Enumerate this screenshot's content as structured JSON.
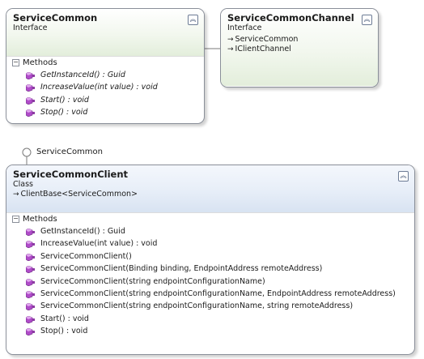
{
  "service_common": {
    "title": "ServiceCommon",
    "kind": "Interface",
    "section": "Methods",
    "methods": [
      "GetInstanceId() : Guid",
      "IncreaseValue(int value) : void",
      "Start() : void",
      "Stop() : void"
    ]
  },
  "service_common_channel": {
    "title": "ServiceCommonChannel",
    "kind": "Interface",
    "inherits": [
      "ServiceCommon",
      "IClientChannel"
    ]
  },
  "lollipop": {
    "label": "ServiceCommon"
  },
  "service_common_client": {
    "title": "ServiceCommonClient",
    "kind": "Class",
    "base": "ClientBase<ServiceCommon>",
    "section": "Methods",
    "methods": [
      "GetInstanceId() : Guid",
      "IncreaseValue(int value) : void",
      "ServiceCommonClient()",
      "ServiceCommonClient(Binding binding, EndpointAddress remoteAddress)",
      "ServiceCommonClient(string endpointConfigurationName)",
      "ServiceCommonClient(string endpointConfigurationName, EndpointAddress remoteAddress)",
      "ServiceCommonClient(string endpointConfigurationName, string remoteAddress)",
      "Start() : void",
      "Stop() : void"
    ]
  }
}
